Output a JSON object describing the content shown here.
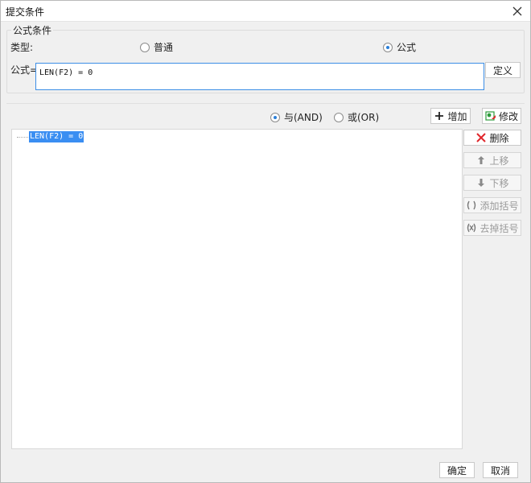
{
  "window": {
    "title": "提交条件"
  },
  "group": {
    "legend": "公式条件"
  },
  "type_row": {
    "label": "类型:",
    "options": [
      {
        "label": "普通",
        "checked": false
      },
      {
        "label": "公式",
        "checked": true
      }
    ]
  },
  "formula": {
    "label": "公式=",
    "value": "LEN(F2) = 0",
    "define_button": "定义"
  },
  "logic": {
    "and_label": "与(AND)",
    "and_checked": true,
    "or_label": "或(OR)",
    "or_checked": false
  },
  "toolbar": {
    "add": "增加",
    "modify": "修改"
  },
  "tree": {
    "nodes": [
      "LEN(F2) = 0"
    ]
  },
  "side_buttons": {
    "delete": "删除",
    "move_up": "上移",
    "move_down": "下移",
    "add_bracket": "添加括号",
    "remove_bracket": "去掉括号"
  },
  "footer": {
    "ok": "确定",
    "cancel": "取消"
  },
  "colors": {
    "accent": "#3a8ef2",
    "delete_red": "#e0262b",
    "modify_green": "#2e9b3c"
  }
}
